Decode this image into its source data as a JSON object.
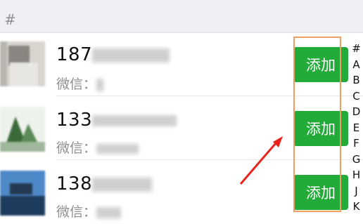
{
  "section": {
    "title": "#"
  },
  "contacts": [
    {
      "name_prefix": "187",
      "wechat_label": "微信：",
      "add_label": "添加"
    },
    {
      "name_prefix": "133",
      "wechat_label": "微信：",
      "add_label": "添加"
    },
    {
      "name_prefix": "138",
      "wechat_label": "微信：",
      "add_label": "添加"
    }
  ],
  "index": [
    "#",
    "A",
    "B",
    "C",
    "D",
    "E",
    "F",
    "G",
    "H",
    "J",
    "K"
  ],
  "colors": {
    "button": "#22ab38",
    "highlight": "#f0a060",
    "arrow": "#e8231e"
  },
  "icons": {
    "arrow": "red-arrow-icon"
  }
}
